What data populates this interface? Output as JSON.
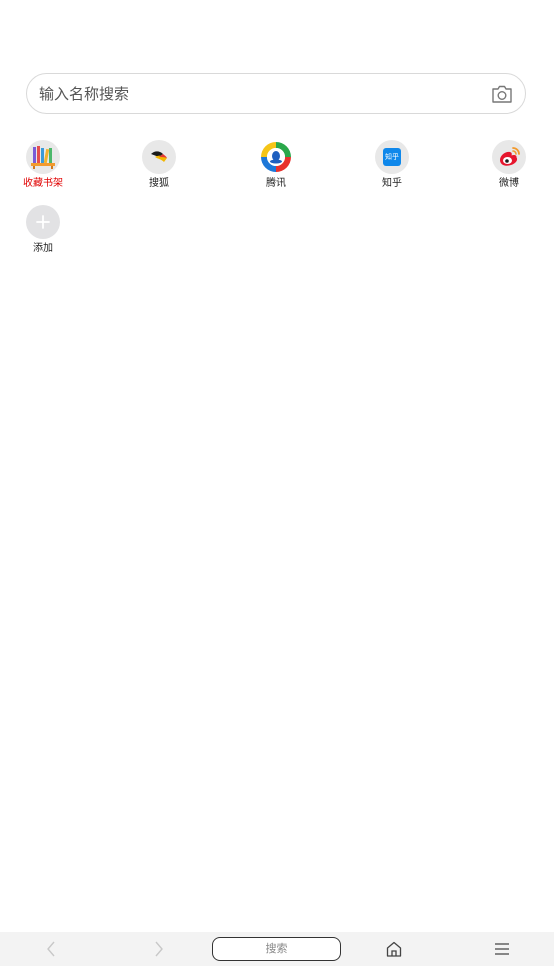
{
  "search": {
    "placeholder": "输入名称搜索"
  },
  "shortcuts": [
    {
      "label": "收藏书架",
      "icon": "bookshelf-icon",
      "highlight": true
    },
    {
      "label": "搜狐",
      "icon": "sohu-icon"
    },
    {
      "label": "腾讯",
      "icon": "tencent-icon"
    },
    {
      "label": "知乎",
      "icon": "zhihu-icon",
      "badge_text": "知乎"
    },
    {
      "label": "微博",
      "icon": "weibo-icon"
    },
    {
      "label": "添加",
      "icon": "add-icon"
    }
  ],
  "bottom_nav": {
    "back_icon": "chevron-left-icon",
    "forward_icon": "chevron-right-icon",
    "search_label": "搜索",
    "home_icon": "home-icon",
    "menu_icon": "menu-icon"
  },
  "colors": {
    "highlight_label": "#e00000",
    "zhihu_blue": "#0f88eb",
    "weibo_red": "#e6162d"
  }
}
